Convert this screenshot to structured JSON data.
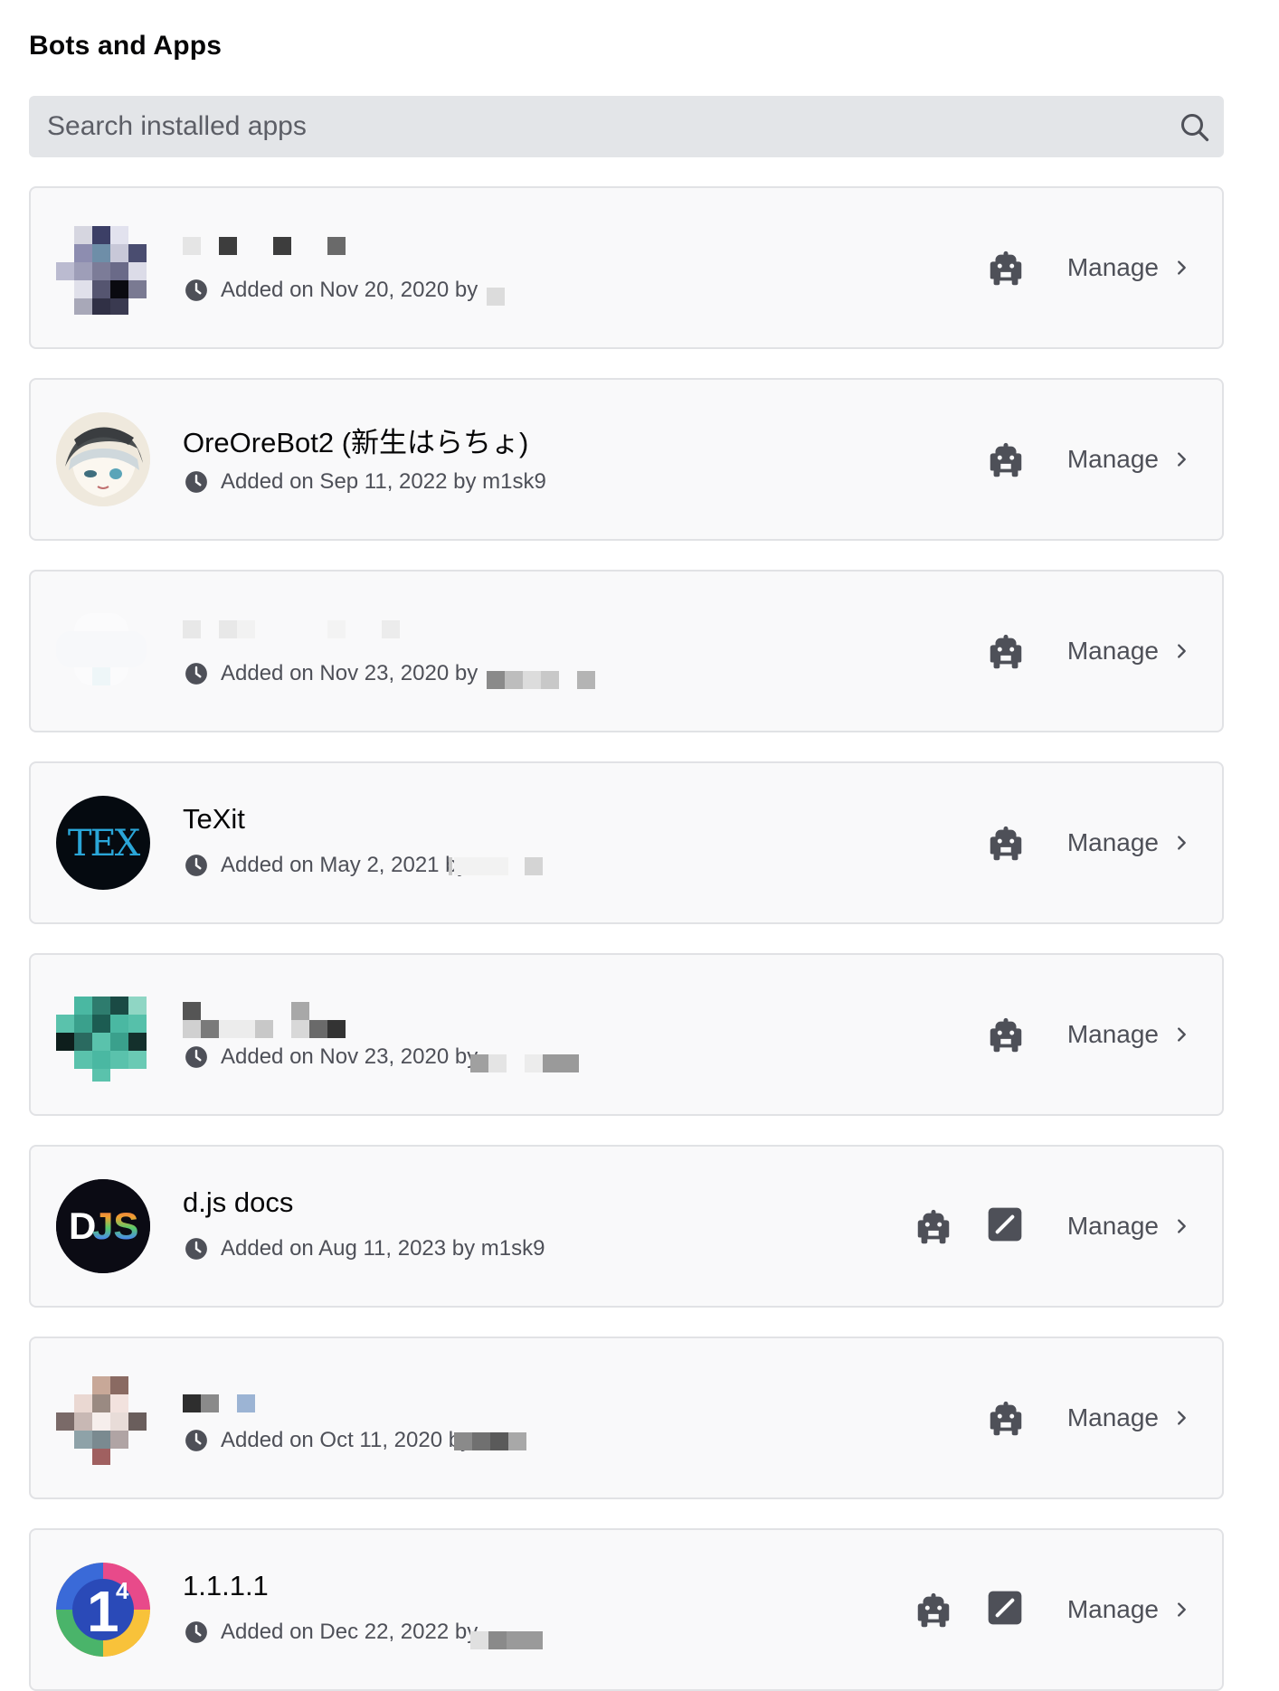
{
  "page": {
    "title": "Bots and Apps"
  },
  "search": {
    "placeholder": "Search installed apps"
  },
  "manage_label": "Manage",
  "apps": [
    {
      "name": "",
      "added_text": "Added on Nov 20, 2020 by",
      "by": "",
      "icons": [
        "bot-icon"
      ]
    },
    {
      "name": "OreOreBot2 (新生はらちょ)",
      "added_text": "Added on Sep 11, 2022 by m1sk9",
      "by": "m1sk9",
      "icons": [
        "bot-icon"
      ]
    },
    {
      "name": "",
      "added_text": "Added on Nov 23, 2020 by",
      "by": "",
      "icons": [
        "bot-icon"
      ]
    },
    {
      "name": "TeXit",
      "added_text": "Added on May 2, 2021 by",
      "by": "",
      "icons": [
        "bot-icon"
      ]
    },
    {
      "name": "",
      "added_text": "Added on Nov 23, 2020 by",
      "by": "",
      "icons": [
        "bot-icon"
      ]
    },
    {
      "name": "d.js docs",
      "added_text": "Added on Aug 11, 2023 by m1sk9",
      "by": "m1sk9",
      "icons": [
        "bot-icon",
        "slash-command-icon"
      ]
    },
    {
      "name": "",
      "added_text": "Added on Oct 11, 2020 by",
      "by": "",
      "icons": [
        "bot-icon"
      ]
    },
    {
      "name": "1.1.1.1",
      "added_text": "Added on Dec 22, 2022 by",
      "by": "",
      "icons": [
        "bot-icon",
        "slash-command-icon"
      ]
    }
  ],
  "avatars": {
    "texit_logo": "TEX",
    "djs_logo": "DJS",
    "cloudflare_logo": "1"
  },
  "colors": {
    "card_bg": "#f9f9fa",
    "card_border": "#e1e2e5",
    "search_bg": "#e3e5e8",
    "icon_gray": "#4e5058",
    "muted_text": "#4e5058"
  }
}
